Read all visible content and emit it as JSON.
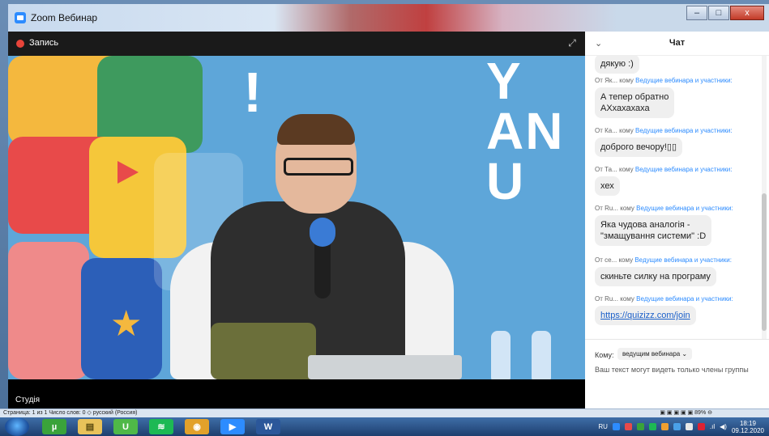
{
  "window": {
    "title": "Zoom Вебинар",
    "min_label": "–",
    "max_label": "□",
    "close_label": "x"
  },
  "video": {
    "record_label": "Запись",
    "expand_icon": "expand-icon",
    "studio_label": "Студія",
    "stage_text": "Y\nAN\nU"
  },
  "chat": {
    "title": "Чат",
    "collapse_icon": "chevron-down-icon",
    "partial_top": "дякую :)",
    "messages": [
      {
        "from": "От Як...",
        "to_word": "кому",
        "to": "Ведущие вебинара и участники:",
        "text": "А тепер обратно\nАХхахахаха",
        "is_link": false
      },
      {
        "from": "От Ка...",
        "to_word": "кому",
        "to": "Ведущие вебинара и участники:",
        "text": "доброго вечору!▯▯",
        "is_link": false
      },
      {
        "from": "От Та...",
        "to_word": "кому",
        "to": "Ведущие вебинара и участники:",
        "text": "хех",
        "is_link": false
      },
      {
        "from": "От Ru...",
        "to_word": "кому",
        "to": "Ведущие вебинара и участники:",
        "text": "Яка чудова аналогія -\n\"змащування системи\" :D",
        "is_link": false
      },
      {
        "from": "От се...",
        "to_word": "кому",
        "to": "Ведущие вебинара и участники:",
        "text": "скиньте силку на програму",
        "is_link": false
      },
      {
        "from": "От Ru...",
        "to_word": "кому",
        "to": "Ведущие вебинара и участники:",
        "text": "https://quizizz.com/join",
        "is_link": true
      }
    ],
    "to_label": "Кому:",
    "to_value": "ведущим вебинара ⌄",
    "hint": "Ваш текст могут видеть только члены группы"
  },
  "wordbar": {
    "left": "Страница: 1 из 1   Число слов: 0   ◇   русский (Россия)",
    "right": "▣ ▣ ▣ ▣ ▣  89%  ⊖"
  },
  "taskbar": {
    "apps": [
      {
        "name": "start",
        "label": ""
      },
      {
        "name": "utorrent-app",
        "label": "µ"
      },
      {
        "name": "explorer-app",
        "label": "▤"
      },
      {
        "name": "utorrent2-app",
        "label": "U"
      },
      {
        "name": "spotify-app",
        "label": "≋"
      },
      {
        "name": "chrome-app",
        "label": "◉"
      },
      {
        "name": "zoom-app",
        "label": "▶"
      },
      {
        "name": "word-app",
        "label": "W"
      }
    ],
    "lang": "RU",
    "time": "18:19",
    "date": "09.12.2020"
  }
}
